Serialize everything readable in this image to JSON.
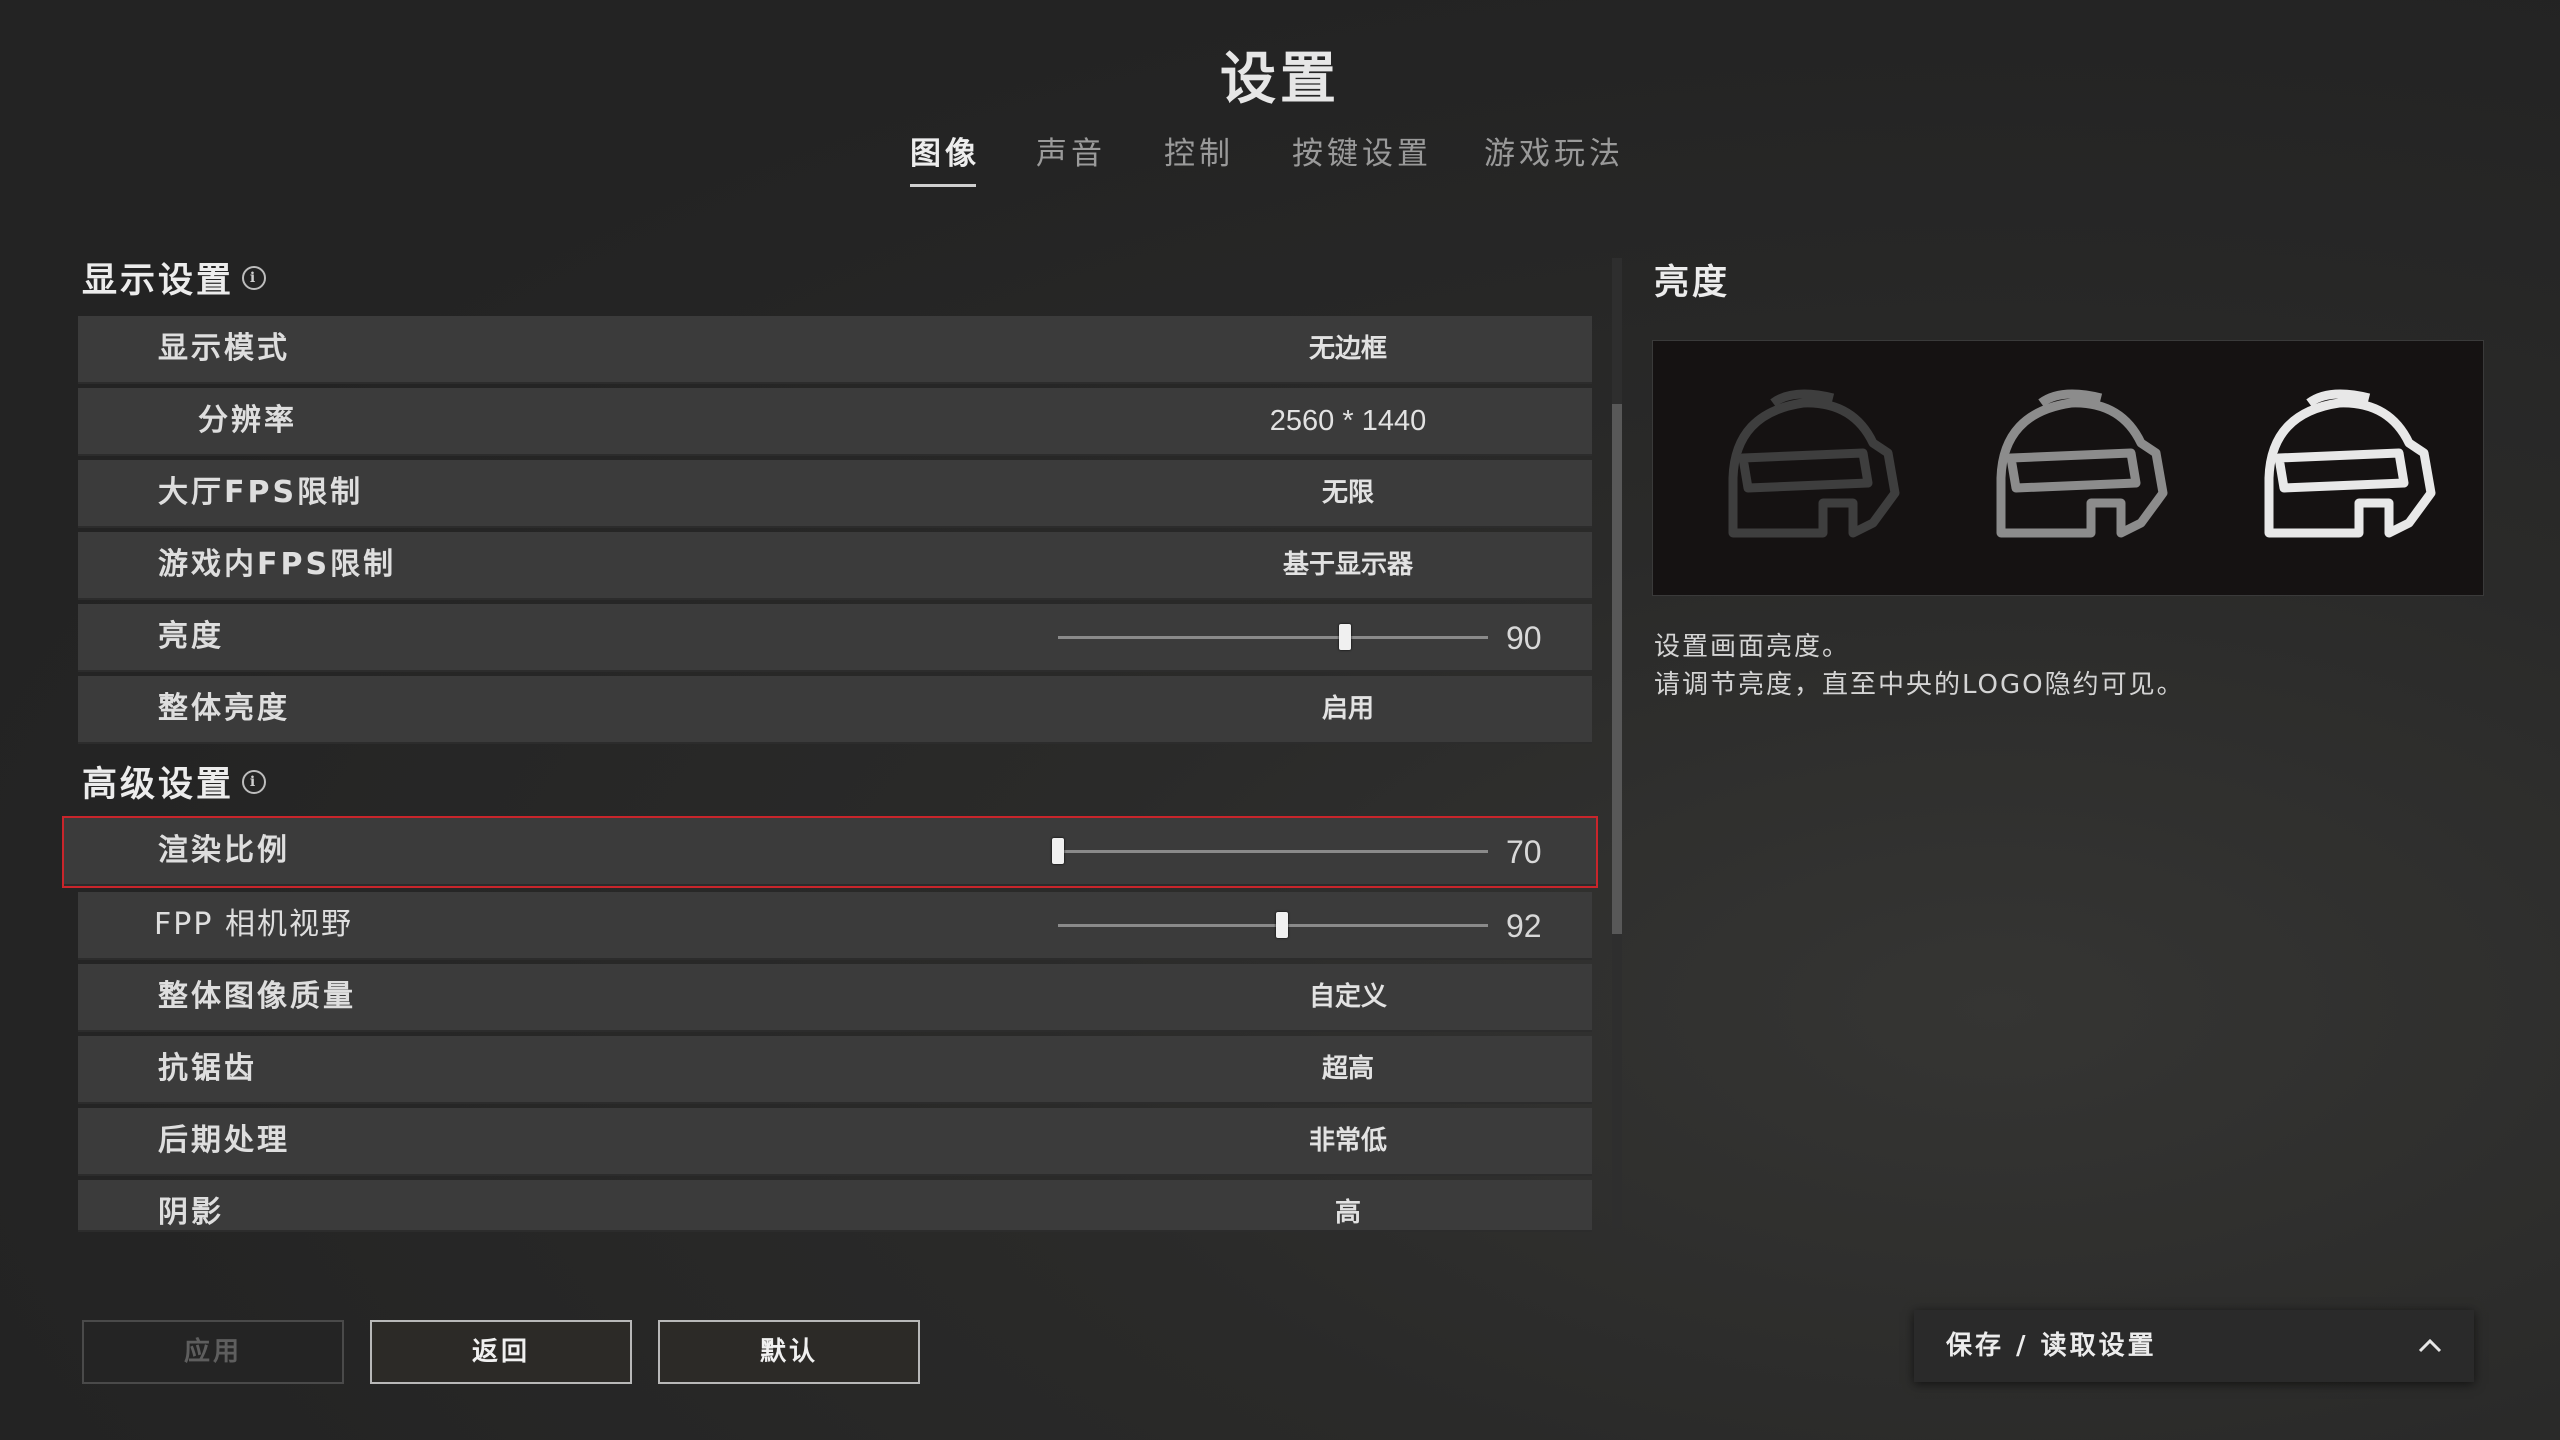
{
  "title": "设置",
  "tabs": [
    {
      "label": "图像",
      "active": true
    },
    {
      "label": "声音",
      "active": false
    },
    {
      "label": "控制",
      "active": false
    },
    {
      "label": "按键设置",
      "active": false
    },
    {
      "label": "游戏玩法",
      "active": false
    }
  ],
  "display_section": {
    "title": "显示设置",
    "rows": [
      {
        "label": "显示模式",
        "value": "无边框"
      },
      {
        "label": "分辨率",
        "value": "2560 * 1440"
      },
      {
        "label": "大厅FPS限制",
        "value": "无限"
      },
      {
        "label": "游戏内FPS限制",
        "value": "基于显示器"
      },
      {
        "label": "亮度",
        "value": "90"
      },
      {
        "label": "整体亮度",
        "value": "启用"
      }
    ]
  },
  "advanced_section": {
    "title": "高级设置",
    "rows": [
      {
        "label": "渲染比例",
        "value": "70"
      },
      {
        "label": "FPP 相机视野",
        "value": "92"
      },
      {
        "label": "整体图像质量",
        "value": "自定义"
      },
      {
        "label": "抗锯齿",
        "value": "超高"
      },
      {
        "label": "后期处理",
        "value": "非常低"
      },
      {
        "label": "阴影",
        "value": "高"
      }
    ]
  },
  "sliders": {
    "brightness": {
      "min": 70,
      "max": 100,
      "value": 90
    },
    "render_scale": {
      "min": 70,
      "max": 120,
      "value": 70
    },
    "fpp_fov": {
      "min": 80,
      "max": 103,
      "value": 92
    }
  },
  "side_panel": {
    "title": "亮度",
    "desc_line1": "设置画面亮度。",
    "desc_line2": "请调节亮度，直至中央的LOGO隐约可见。",
    "helmet_shades": [
      "#3e3e3e",
      "#8c8c8c",
      "#e8e8e8"
    ]
  },
  "buttons": {
    "apply": "应用",
    "back": "返回",
    "default": "默认"
  },
  "save_load": {
    "label": "保存 / 读取设置",
    "icon": "chevron-up-icon"
  },
  "colors": {
    "selection_outline": "#c9252b"
  }
}
